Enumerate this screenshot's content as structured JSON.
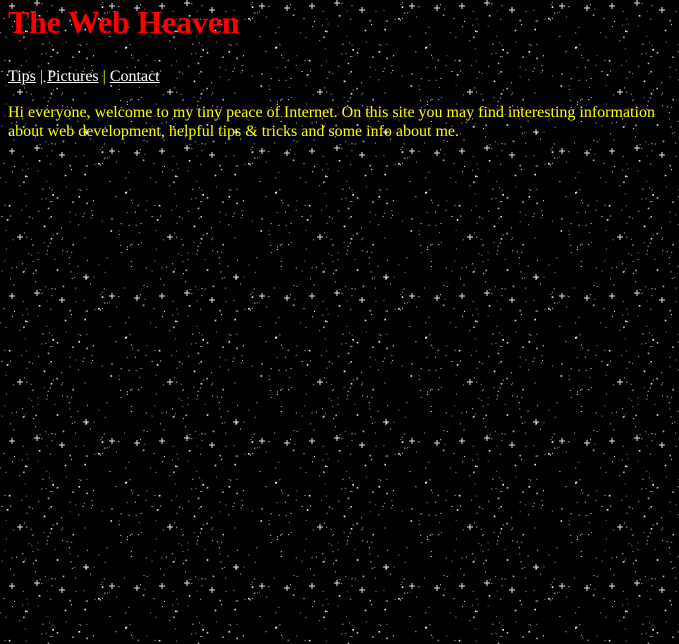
{
  "site": {
    "title": "The Web Heaven"
  },
  "nav": {
    "items": [
      {
        "label": "Tips"
      },
      {
        "label": "Pictures"
      },
      {
        "label": "Contact"
      }
    ],
    "separator": "|"
  },
  "intro": {
    "text": "Hi everyone, welcome to my tiny peace of Internet. On this site you may find interesting information about web development, helpful tips & tricks and some info about me."
  },
  "colors": {
    "background": "#000000",
    "title": "#ff0000",
    "link": "#ffffff",
    "separator": "#ffff00",
    "body_text": "#ffff00",
    "star": "#ffffff"
  },
  "icons": {
    "background": "starfield-pattern"
  }
}
